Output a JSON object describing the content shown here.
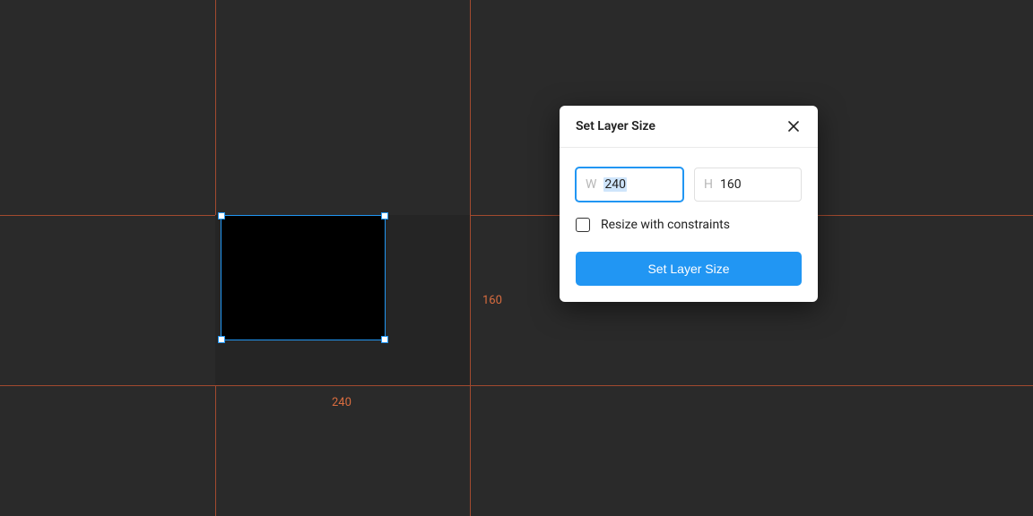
{
  "canvas": {
    "ruler_label_width": "240",
    "ruler_label_height": "160"
  },
  "dialog": {
    "title": "Set Layer Size",
    "width_prefix": "W",
    "width_value": "240",
    "height_prefix": "H",
    "height_value": "160",
    "resize_constraints_label": "Resize with constraints",
    "submit_label": "Set Layer Size"
  }
}
